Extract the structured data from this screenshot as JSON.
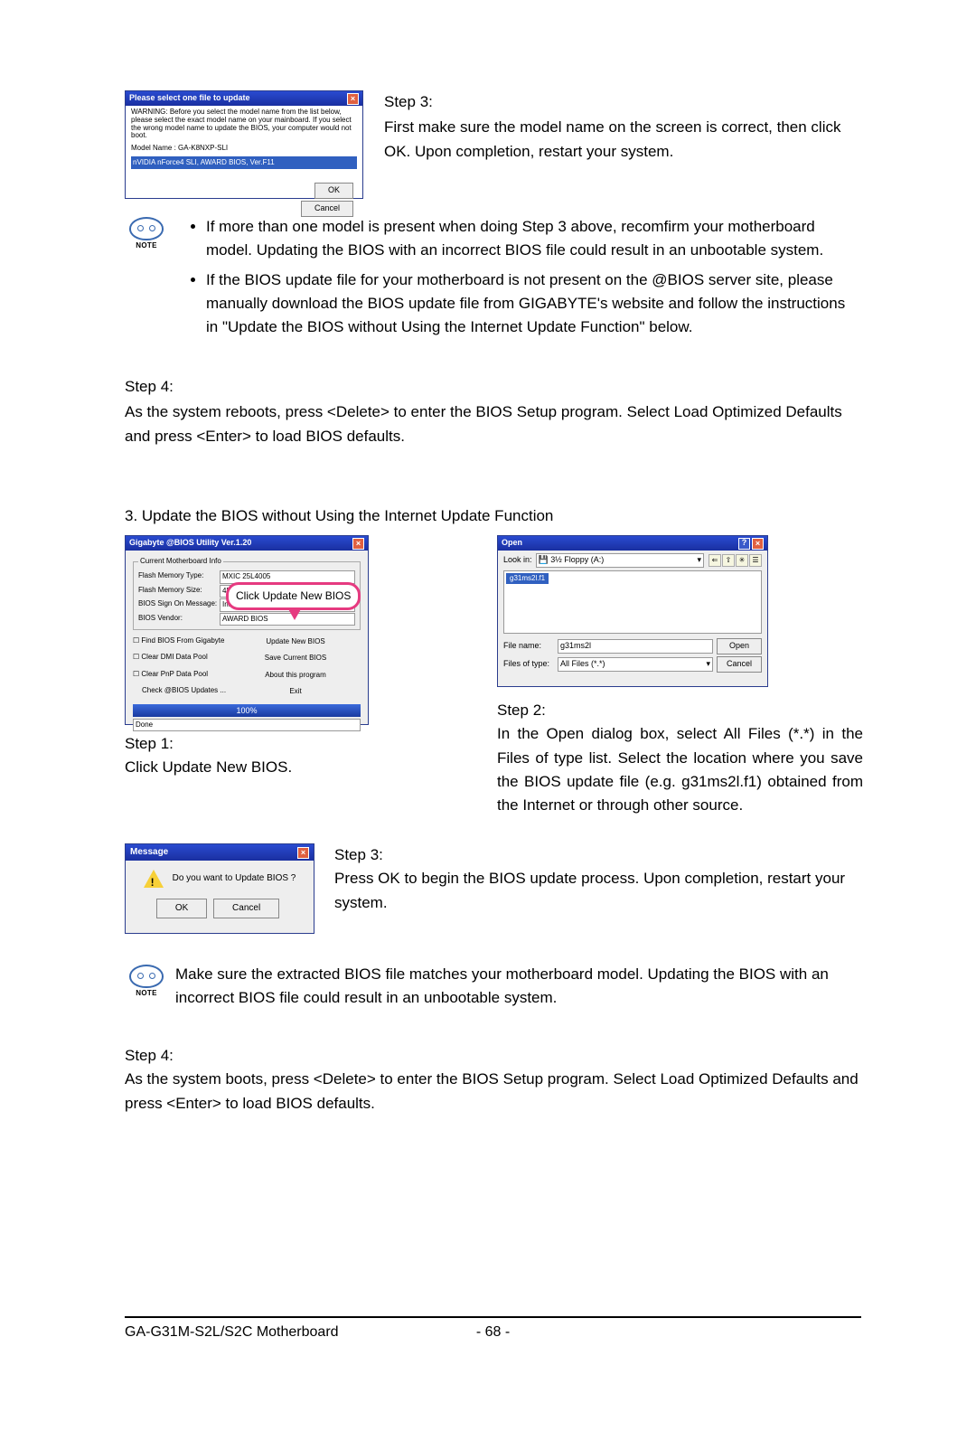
{
  "dialog1": {
    "title": "Please select one file to update",
    "warning": "WARNING: Before you select the model name from the list below, please select the exact model name on your mainboard. If you select the wrong model name to update the BIOS, your computer would not boot.",
    "model_label": "Model Name : GA-K8NXP-SLI",
    "selected": "nVIDIA nForce4 SLI, AWARD BIOS, Ver.F11",
    "ok": "OK",
    "cancel": "Cancel"
  },
  "topstep3": {
    "title": "Step 3:",
    "body": "First make sure the model name on the screen is correct, then click OK. Upon completion, restart your system."
  },
  "note1": {
    "label": "NOTE",
    "items": [
      "If more than one model is present when doing Step 3 above, recomfirm your motherboard model. Updating the BIOS with an incorrect BIOS file could result in an unbootable system.",
      "If the BIOS update file for your motherboard is not present on the @BIOS server site, please manually download the BIOS update file from GIGABYTE's website and follow the instructions in \"Update the BIOS without Using the Internet Update Function\" below."
    ]
  },
  "step4a": {
    "title": "Step 4:",
    "body": "As the system reboots, press <Delete> to enter the BIOS Setup program. Select Load Optimized Defaults and press <Enter> to load BIOS defaults."
  },
  "section3": "3.   Update the BIOS without Using the Internet Update Function",
  "util": {
    "title": "Gigabyte @BIOS Utility Ver.1.20",
    "legend": "Current Motherboard Info",
    "rows": {
      "flash_type_k": "Flash Memory Type:",
      "flash_type_v": "MXIC 25L4005",
      "flash_size_k": "Flash Memory Size:",
      "flash_size_v": "4M Bits",
      "signon_k": "BIOS Sign On Message:",
      "signon_v": "Intel G31",
      "vendor_k": "BIOS Vendor:",
      "vendor_v": "AWARD BIOS"
    },
    "left": {
      "find": "Find BIOS From Gigabyte",
      "dmi": "Clear DMI Data Pool",
      "pnp": "Clear PnP Data Pool",
      "check": "Check @BIOS Updates ..."
    },
    "right": {
      "update": "Update New BIOS",
      "save": "Save Current BIOS",
      "about": "About this program",
      "exit": "Exit"
    },
    "progress": "100%",
    "status": "Done"
  },
  "callout": "Click  Update New BIOS",
  "step1": {
    "title": "Step 1:",
    "body": "Click Update New BIOS."
  },
  "opendlg": {
    "title": "Open",
    "lookin": "Look in:",
    "lookin_val": "3½ Floppy (A:)",
    "file_sel": "g31ms2l.f1",
    "filename_lbl": "File name:",
    "filename_val": "g31ms2l",
    "filetype_lbl": "Files of type:",
    "filetype_val": "All Files (*.*)",
    "open": "Open",
    "cancel": "Cancel"
  },
  "step2": {
    "title": "Step 2:",
    "body": "In the Open dialog box, select  All Files (*.*) in the Files of type list. Select the location where you save the BIOS update file (e.g. g31ms2l.f1) obtained from the Internet or through other source."
  },
  "msgbox": {
    "title": "Message",
    "body": "Do you want to Update BIOS ?",
    "ok": "OK",
    "cancel": "Cancel"
  },
  "step3b": {
    "title": "Step 3:",
    "body": "Press OK to begin the BIOS update process. Upon completion, restart your system."
  },
  "note2": {
    "label": "NOTE",
    "body": "Make sure the extracted BIOS file matches your motherboard model. Updating the BIOS with an incorrect BIOS file could result in an unbootable system."
  },
  "step4b": {
    "title": "Step 4:",
    "body": "As the system boots, press <Delete> to enter the BIOS Setup program. Select Load Optimized Defaults and press <Enter> to load BIOS defaults."
  },
  "footer": {
    "left": "GA-G31M-S2L/S2C Motherboard",
    "center": "- 68 -"
  }
}
